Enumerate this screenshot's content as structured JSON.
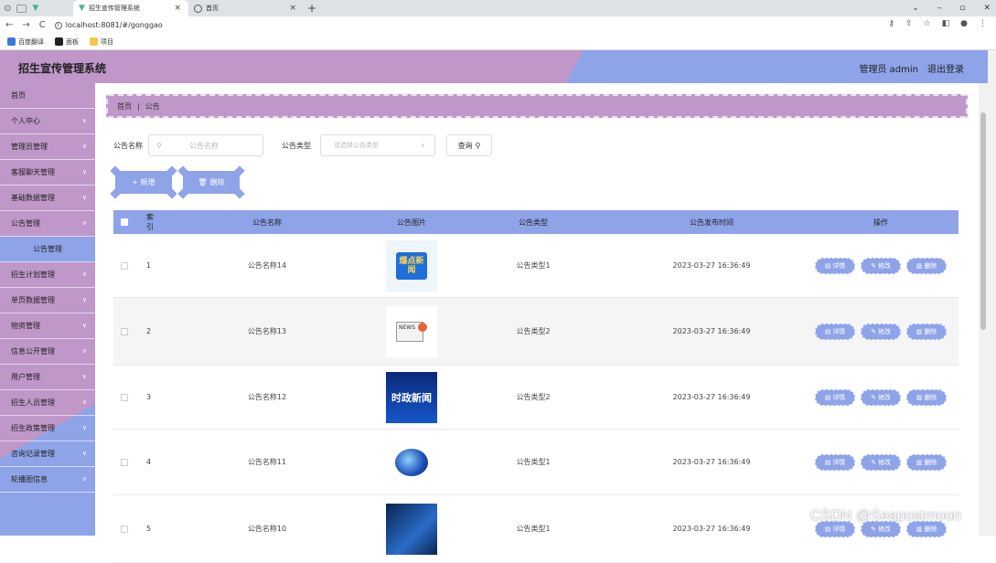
{
  "browser": {
    "tabs": [
      {
        "title": "招生宣传管理系统",
        "active": true
      },
      {
        "title": "首页",
        "active": false
      }
    ],
    "url": "localhost:8081/#/gonggao",
    "bookmarks": [
      "百度翻译",
      "面板",
      "项目"
    ]
  },
  "header": {
    "title": "招生宣传管理系统",
    "user": "管理员 admin",
    "logout": "退出登录"
  },
  "sidebar": {
    "items": [
      {
        "label": "首页",
        "chevron": false
      },
      {
        "label": "个人中心",
        "chevron": true
      },
      {
        "label": "管理员管理",
        "chevron": true
      },
      {
        "label": "客服聊天管理",
        "chevron": true
      },
      {
        "label": "基础数据管理",
        "chevron": true
      },
      {
        "label": "公告管理",
        "chevron": true
      },
      {
        "label": "公告管理",
        "chevron": false,
        "sub": true
      },
      {
        "label": "招生计划管理",
        "chevron": true
      },
      {
        "label": "单页数据管理",
        "chevron": true
      },
      {
        "label": "物资管理",
        "chevron": true
      },
      {
        "label": "信息公开管理",
        "chevron": true
      },
      {
        "label": "用户管理",
        "chevron": true
      },
      {
        "label": "招生人员管理",
        "chevron": true
      },
      {
        "label": "招生政策管理",
        "chevron": true
      },
      {
        "label": "咨询记录管理",
        "chevron": true
      },
      {
        "label": "轮播图信息",
        "chevron": true
      }
    ]
  },
  "breadcrumb": {
    "home": "首页",
    "sep": "|",
    "current": "公告"
  },
  "search": {
    "name_label": "公告名称",
    "name_placeholder": "公告名称",
    "type_label": "公告类型",
    "type_placeholder": "请选择公告类型",
    "query_label": "查询"
  },
  "actions": {
    "add": "+ 新增",
    "delete": "删除"
  },
  "table": {
    "headers": {
      "index": "索引",
      "name": "公告名称",
      "image": "公告图片",
      "type": "公告类型",
      "time": "公告发布时间",
      "ops": "操作"
    },
    "ops": {
      "detail": "详情",
      "edit": "修改",
      "delete": "删除"
    },
    "rows": [
      {
        "index": "1",
        "name": "公告名称14",
        "type": "公告类型1",
        "time": "2023-03-27 16:36:49",
        "thumb_text": "爆点新闻"
      },
      {
        "index": "2",
        "name": "公告名称13",
        "type": "公告类型2",
        "time": "2023-03-27 16:36:49",
        "thumb_text": "NEWS"
      },
      {
        "index": "3",
        "name": "公告名称12",
        "type": "公告类型2",
        "time": "2023-03-27 16:36:49",
        "thumb_text": "时政新闻"
      },
      {
        "index": "4",
        "name": "公告名称11",
        "type": "公告类型1",
        "time": "2023-03-27 16:36:49",
        "thumb_text": ""
      },
      {
        "index": "5",
        "name": "公告名称10",
        "type": "公告类型1",
        "time": "2023-03-27 16:36:49",
        "thumb_text": ""
      }
    ]
  },
  "watermark": "CSDN @Seapostmoon",
  "colors": {
    "purple": "#bf97c8",
    "blue": "#8ea3e8"
  }
}
